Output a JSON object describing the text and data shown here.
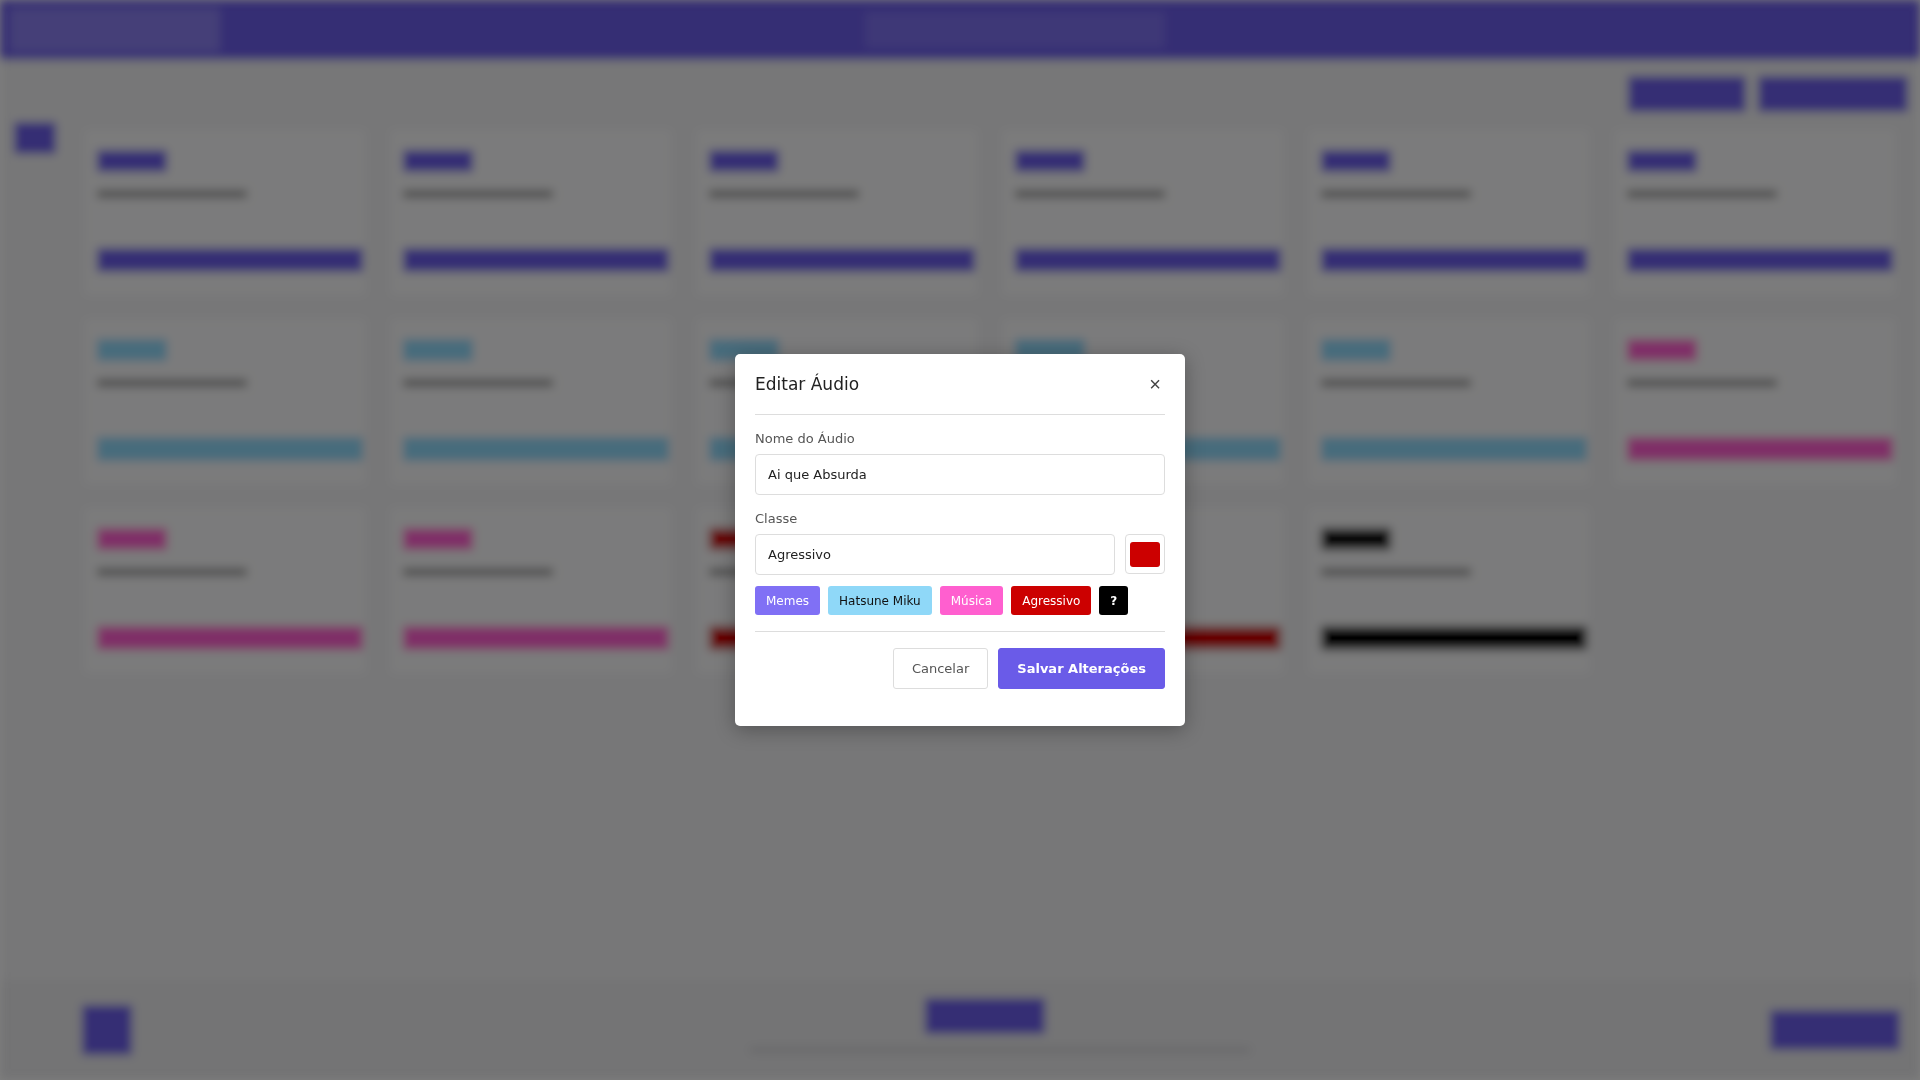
{
  "dialog": {
    "title": "Editar Áudio",
    "close": "×",
    "name_field": {
      "label": "Nome do Áudio",
      "value": "Ai que Absurda"
    },
    "class_field": {
      "label": "Classe",
      "value": "Agressivo",
      "color": "#cc0000"
    },
    "tags": [
      {
        "label": "Memes",
        "color": "#8070f5"
      },
      {
        "label": "Hatsune Miku",
        "color": "#8fd8f8"
      },
      {
        "label": "Música",
        "color": "#ff5fcf"
      },
      {
        "label": "Agressivo",
        "color": "#cc0000"
      },
      {
        "label": "?",
        "color": "#000000"
      }
    ],
    "buttons": [
      {
        "label": "Cancelar",
        "kind": "secondary"
      },
      {
        "label": "Salvar Alterações",
        "kind": "primary"
      }
    ]
  }
}
